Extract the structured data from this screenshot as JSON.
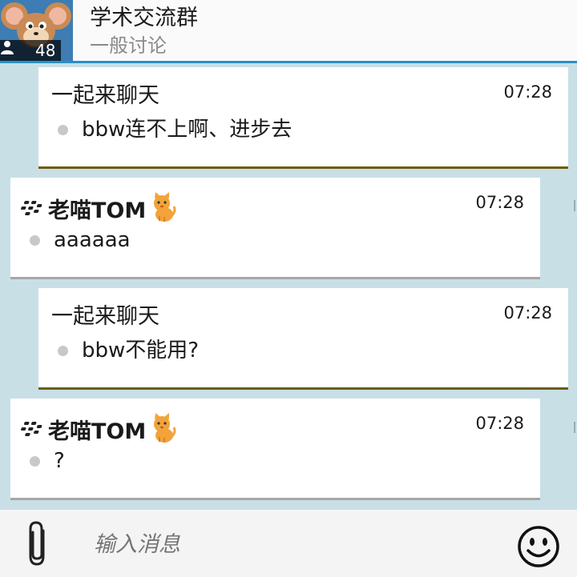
{
  "header": {
    "title": "学术交流群",
    "subtitle": "一般讨论",
    "member_count": "48"
  },
  "messages": [
    {
      "sender": "一起来聊天",
      "time": "07:28",
      "text": "bbw连不上啊、进步去",
      "direction": "outgoing"
    },
    {
      "sender": "老喵TOM",
      "time": "07:28",
      "text": "aaaaaa",
      "direction": "incoming"
    },
    {
      "sender": "一起来聊天",
      "time": "07:28",
      "text": "bbw不能用?",
      "direction": "outgoing"
    },
    {
      "sender": "老喵TOM",
      "time": "07:28",
      "text": "?",
      "direction": "incoming"
    }
  ],
  "composer": {
    "placeholder": "输入消息"
  },
  "icons": {
    "attach": "paperclip-icon",
    "emoji": "smiley-icon",
    "member": "person-icon",
    "bbm": "blackberry-icon",
    "cat": "cat-emoji-icon"
  },
  "colors": {
    "header_accent": "#2a8fc4",
    "outgoing_border": "#6b5d12",
    "incoming_border": "#a6a6a6",
    "background": "#c9dfe6"
  }
}
